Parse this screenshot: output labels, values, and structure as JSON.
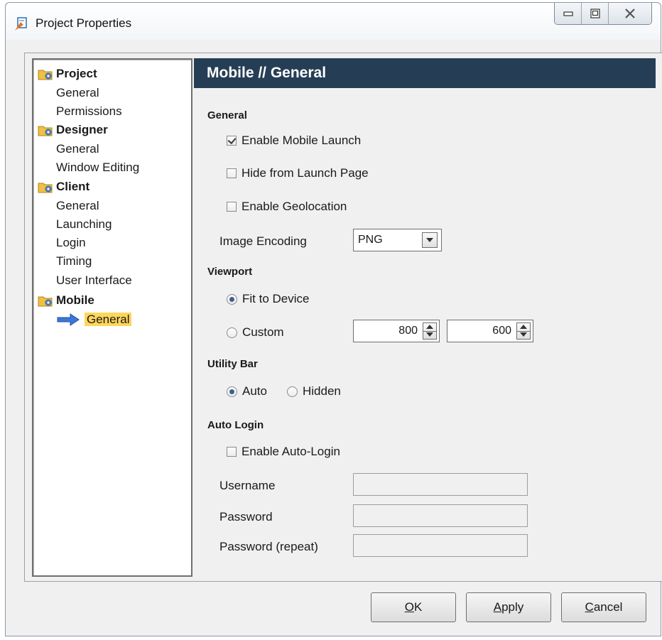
{
  "window": {
    "title": "Project Properties",
    "icon": "project-properties-icon"
  },
  "tree": {
    "groups": [
      {
        "label": "Project",
        "icon": "folder-gear-icon",
        "children": [
          "General",
          "Permissions"
        ]
      },
      {
        "label": "Designer",
        "icon": "folder-gear-icon",
        "children": [
          "General",
          "Window Editing"
        ]
      },
      {
        "label": "Client",
        "icon": "folder-gear-icon",
        "children": [
          "General",
          "Launching",
          "Login",
          "Timing",
          "User Interface"
        ]
      },
      {
        "label": "Mobile",
        "icon": "folder-gear-icon",
        "children": [
          "General"
        ]
      }
    ],
    "selected": "Mobile // General"
  },
  "panel": {
    "header": "Mobile // General",
    "general": {
      "title": "General",
      "enable_mobile_launch": {
        "label": "Enable Mobile Launch",
        "checked": true
      },
      "hide_from_launch_page": {
        "label": "Hide from Launch Page",
        "checked": false
      },
      "enable_geolocation": {
        "label": "Enable Geolocation",
        "checked": false
      },
      "image_encoding": {
        "label": "Image Encoding",
        "value": "PNG"
      }
    },
    "viewport": {
      "title": "Viewport",
      "fit_to_device": {
        "label": "Fit to Device",
        "checked": true
      },
      "custom": {
        "label": "Custom",
        "checked": false
      },
      "width": "800",
      "height": "600"
    },
    "utility_bar": {
      "title": "Utility Bar",
      "auto": {
        "label": "Auto",
        "checked": true
      },
      "hidden": {
        "label": "Hidden",
        "checked": false
      }
    },
    "auto_login": {
      "title": "Auto Login",
      "enable": {
        "label": "Enable Auto-Login",
        "checked": false
      },
      "username_label": "Username",
      "password_label": "Password",
      "password_repeat_label": "Password (repeat)",
      "username": "",
      "password": "",
      "password_repeat": ""
    }
  },
  "buttons": {
    "ok": {
      "mnemonic": "O",
      "rest": "K"
    },
    "apply": {
      "mnemonic": "A",
      "rest": "pply"
    },
    "cancel": {
      "mnemonic": "C",
      "rest": "ancel"
    }
  },
  "colors": {
    "header_bg": "#263e55",
    "selected_bg": "#ffd65c",
    "dialog_bg": "#f0f0f0"
  }
}
